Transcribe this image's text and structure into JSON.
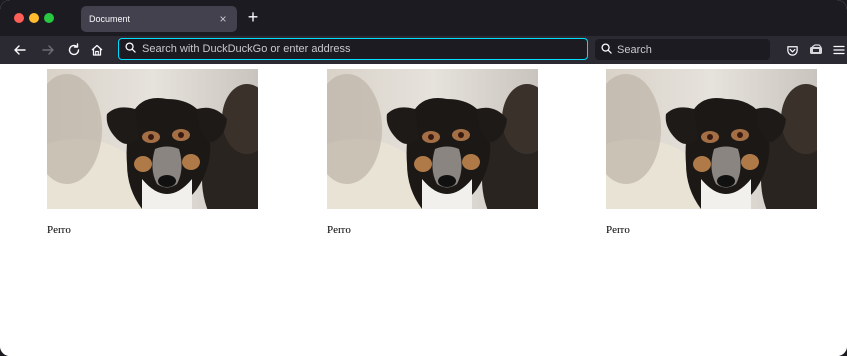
{
  "window": {
    "tab": {
      "title": "Document",
      "close_glyph": "×"
    },
    "new_tab_glyph": "+"
  },
  "toolbar": {
    "address_placeholder": "Search with DuckDuckGo or enter address",
    "search_placeholder": "Search",
    "icons": [
      "back-arrow-icon",
      "forward-arrow-icon",
      "reload-icon",
      "home-icon",
      "search-icon",
      "pocket-icon",
      "extension-icon",
      "menu-icon"
    ]
  },
  "content": {
    "cards": [
      {
        "image": "dog-photo",
        "caption": "Perro"
      },
      {
        "image": "dog-photo",
        "caption": "Perro"
      },
      {
        "image": "dog-photo",
        "caption": "Perro"
      }
    ]
  },
  "colors": {
    "tabstrip": "#1c1b22",
    "toolbar": "#2b2a33",
    "active_tab": "#42414d",
    "focus_ring": "#00ddff",
    "text_light": "#fbfbfe"
  }
}
